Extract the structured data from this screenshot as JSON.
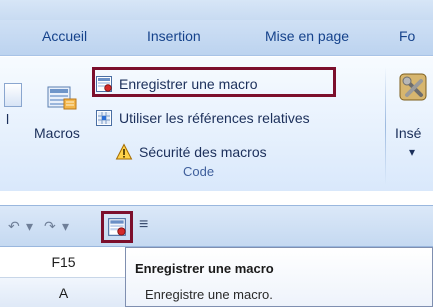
{
  "ribbon": {
    "tabs": [
      {
        "label": "Accueil"
      },
      {
        "label": "Insertion"
      },
      {
        "label": "Mise en page"
      },
      {
        "label": "Fo"
      }
    ],
    "macros_group": {
      "big_button_label": "Macros",
      "left_partial_label": "l",
      "commands": [
        {
          "label": "Enregistrer une macro",
          "icon": "record-macro-icon"
        },
        {
          "label": "Utiliser les références relatives",
          "icon": "relative-references-icon"
        },
        {
          "label": "Sécurité des macros",
          "icon": "macro-security-warning-icon"
        }
      ],
      "group_label": "Code"
    },
    "insert_group": {
      "partial_label": "Insé"
    }
  },
  "quick_access_toolbar": {
    "icons": [
      "undo-icon",
      "redo-icon",
      "customize-qat-icon"
    ],
    "highlighted_icon": "record-macro-icon"
  },
  "name_box": {
    "value": "F15"
  },
  "column_header": {
    "label": "A"
  },
  "tooltip": {
    "title": "Enregistrer une macro",
    "body": "Enregistre une macro."
  },
  "colors": {
    "highlight_border": "#7c0f2c",
    "tab_text": "#15428b",
    "ribbon_text": "#1b2f5a"
  }
}
